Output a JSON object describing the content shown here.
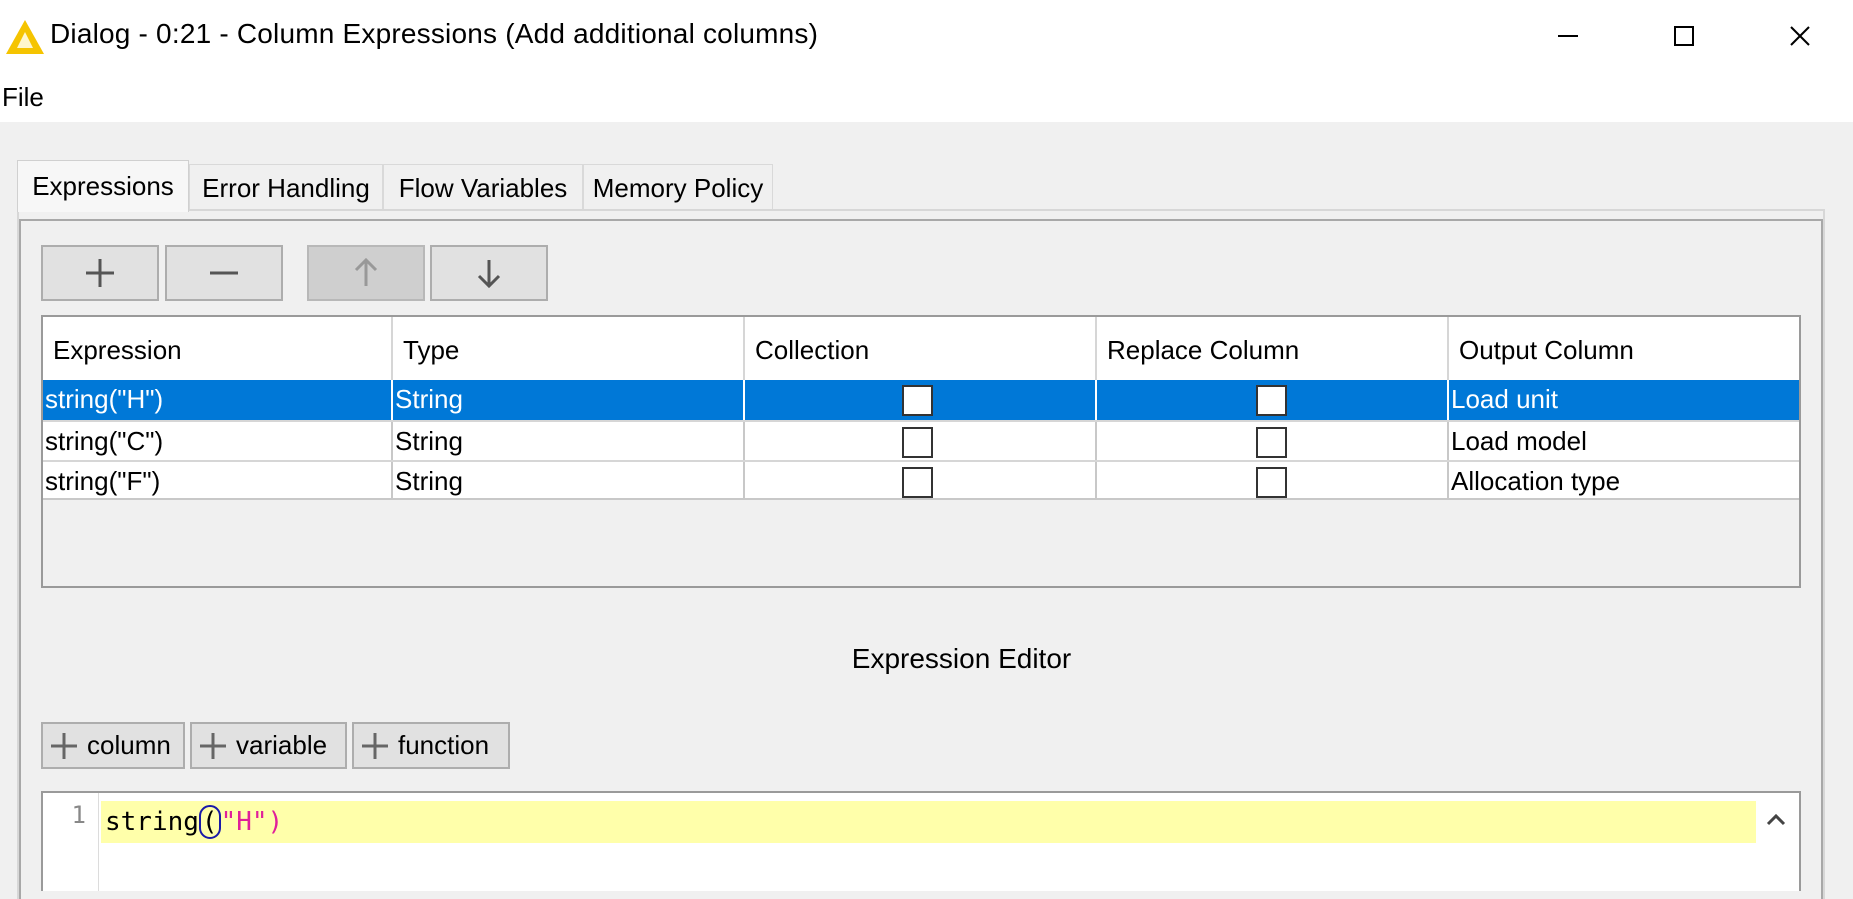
{
  "window": {
    "title": "Dialog - 0:21 - Column Expressions (Add additional columns)",
    "icon": "warning-triangle-icon",
    "controls": [
      "minimize-icon",
      "maximize-icon",
      "close-icon"
    ]
  },
  "menu": {
    "items": [
      {
        "label": "File"
      }
    ]
  },
  "tabs": [
    {
      "label": "Expressions",
      "active": true
    },
    {
      "label": "Error Handling",
      "active": false
    },
    {
      "label": "Flow Variables",
      "active": false
    },
    {
      "label": "Memory Policy",
      "active": false
    }
  ],
  "toolbar": {
    "buttons": [
      {
        "icon": "plus-icon",
        "enabled": true
      },
      {
        "icon": "minus-icon",
        "enabled": true
      },
      {
        "icon": "arrow-up-icon",
        "enabled": false
      },
      {
        "icon": "arrow-down-icon",
        "enabled": true
      }
    ]
  },
  "table": {
    "columns": [
      "Expression",
      "Type",
      "Collection",
      "Replace Column",
      "Output Column"
    ],
    "rows": [
      {
        "expression": "string(\"H\")",
        "type": "String",
        "collection": false,
        "replace": false,
        "output": "Load unit",
        "selected": true
      },
      {
        "expression": "string(\"C\")",
        "type": "String",
        "collection": false,
        "replace": false,
        "output": "Load model",
        "selected": false
      },
      {
        "expression": "string(\"F\")",
        "type": "String",
        "collection": false,
        "replace": false,
        "output": "Allocation type",
        "selected": false
      }
    ]
  },
  "editor": {
    "title": "Expression Editor",
    "buttons": [
      {
        "label": "column",
        "icon": "plus-icon"
      },
      {
        "label": "variable",
        "icon": "plus-icon"
      },
      {
        "label": "function",
        "icon": "plus-icon"
      }
    ],
    "line_number": "1",
    "code": {
      "fn": "string",
      "open": "(",
      "arg": "\"H\"",
      "close": ")"
    }
  },
  "colors": {
    "selection": "#0078d7",
    "current_line": "#ffffaa",
    "string_literal": "#e0209a",
    "warning_icon": "#f5c400"
  }
}
